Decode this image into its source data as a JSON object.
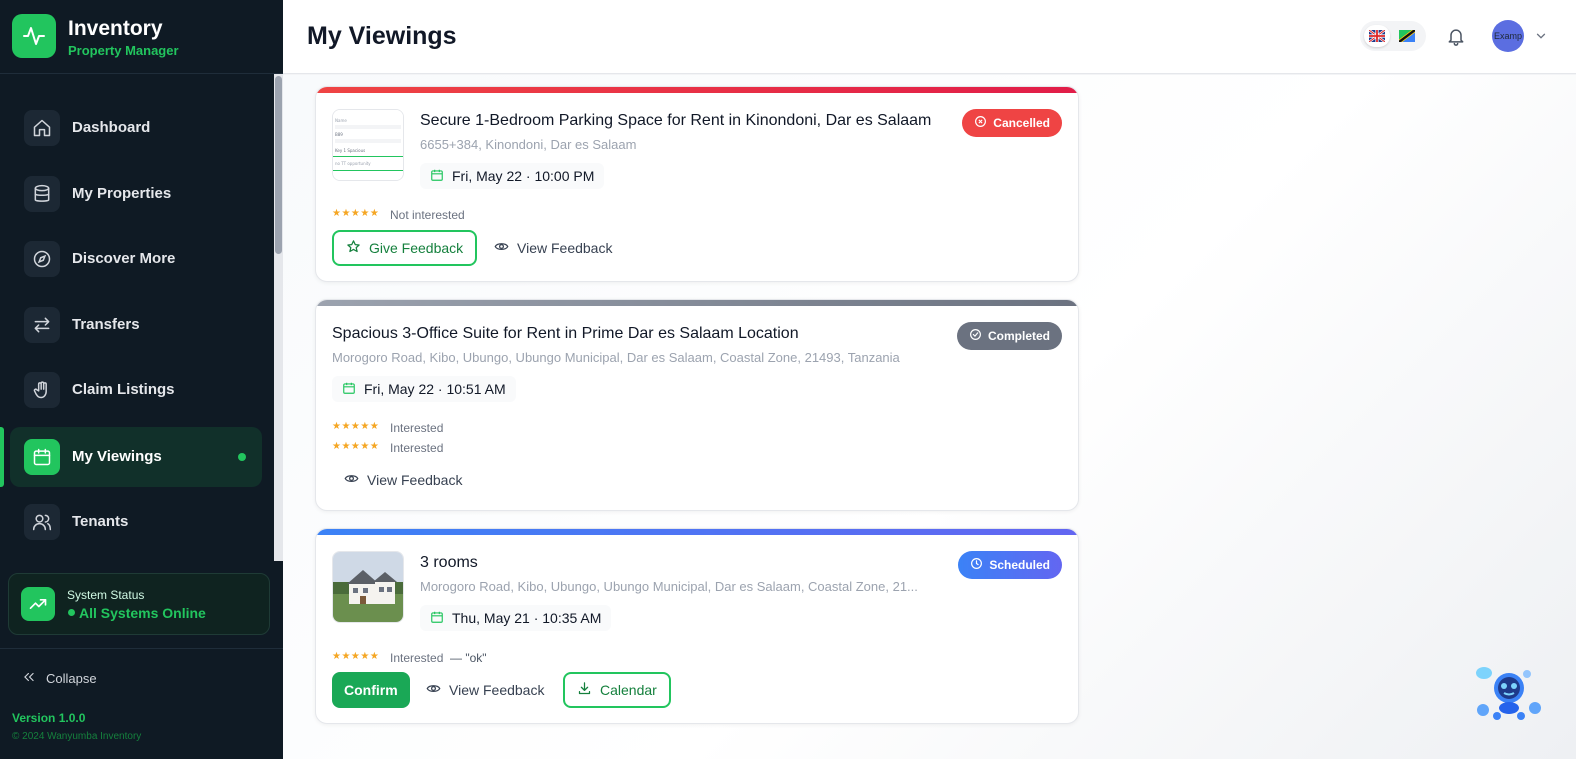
{
  "sidebar": {
    "brand_title": "Inventory",
    "brand_subtitle": "Property Manager",
    "items": [
      {
        "label": "Dashboard",
        "icon": "home-icon"
      },
      {
        "label": "My Properties",
        "icon": "database-icon"
      },
      {
        "label": "Discover More",
        "icon": "compass-icon"
      },
      {
        "label": "Transfers",
        "icon": "arrows-swap-icon"
      },
      {
        "label": "Claim Listings",
        "icon": "hand-icon"
      },
      {
        "label": "My Viewings",
        "icon": "calendar-icon",
        "active": true
      },
      {
        "label": "Tenants",
        "icon": "users-icon"
      }
    ],
    "system_status_label": "System Status",
    "system_status_value": "All Systems Online",
    "collapse_label": "Collapse",
    "version": "Version 1.0.0",
    "copyright": "© 2024 Wanyumba Inventory"
  },
  "header": {
    "title": "My Viewings",
    "avatar_text": "Examp"
  },
  "cards": [
    {
      "title": "Secure 1-Bedroom Parking Space for Rent in Kinondoni, Dar es Salaam",
      "address": "6655+384, Kinondoni, Dar es Salaam",
      "date": "Fri, May 22 · 10:00 PM",
      "status": "Cancelled",
      "ratings": [
        {
          "stars": "★★★★★",
          "text": "Not interested",
          "comment": ""
        }
      ],
      "buttons": {
        "give_feedback": "Give Feedback",
        "view_feedback": "View Feedback"
      }
    },
    {
      "title": "Spacious 3-Office Suite for Rent in Prime Dar es Salaam Location",
      "address": "Morogoro Road, Kibo, Ubungo, Ubungo Municipal, Dar es Salaam, Coastal Zone, 21493, Tanzania",
      "date": "Fri, May 22 · 10:51 AM",
      "status": "Completed",
      "ratings": [
        {
          "stars": "★★★★★",
          "text": "Interested",
          "comment": ""
        },
        {
          "stars": "★★★★★",
          "text": "Interested",
          "comment": ""
        }
      ],
      "buttons": {
        "view_feedback": "View Feedback"
      }
    },
    {
      "title": "3 rooms",
      "address": "Morogoro Road, Kibo, Ubungo, Ubungo Municipal, Dar es Salaam, Coastal Zone, 21...",
      "date": "Thu, May 21 · 10:35 AM",
      "status": "Scheduled",
      "ratings": [
        {
          "stars": "★★★★★",
          "text": "Interested",
          "comment": "— \"ok\""
        }
      ],
      "buttons": {
        "confirm": "Confirm",
        "view_feedback": "View Feedback",
        "calendar": "Calendar"
      }
    }
  ],
  "colors": {
    "accent": "#22c55e",
    "cancelled": "#ef4444",
    "completed": "#6b7280",
    "scheduled": "#4f63ef",
    "sidebar_bg": "#0f1a24"
  }
}
